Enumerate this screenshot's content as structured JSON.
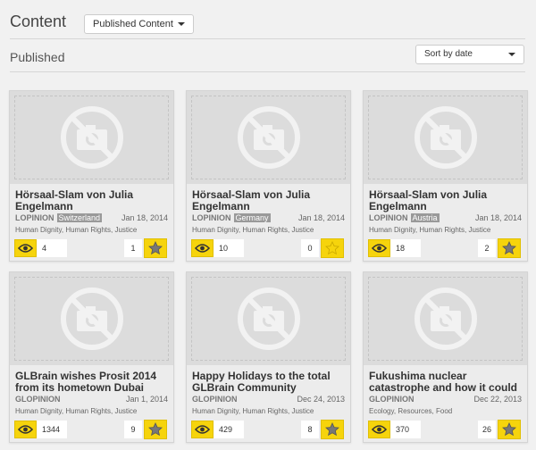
{
  "header": {
    "title": "Content",
    "filter": "Published Content",
    "section": "Published",
    "sort": "Sort by date"
  },
  "colors": {
    "accent": "#f6d40c",
    "tag_bg": "#999999"
  },
  "cards": [
    {
      "title": "Hörsaal-Slam von Julia Engelmann",
      "author": "LOPINION",
      "tag": "Switzerland",
      "date": "Jan 18, 2014",
      "topics": "Human Dignity, Human Rights, Justice",
      "views": "4",
      "count": "1",
      "starred": false
    },
    {
      "title": "Hörsaal-Slam von Julia Engelmann",
      "author": "LOPINION",
      "tag": "Germany",
      "date": "Jan 18, 2014",
      "topics": "Human Dignity, Human Rights, Justice",
      "views": "10",
      "count": "0",
      "starred": true
    },
    {
      "title": "Hörsaal-Slam von Julia Engelmann",
      "author": "LOPINION",
      "tag": "Austria",
      "date": "Jan 18, 2014",
      "topics": "Human Dignity, Human Rights, Justice",
      "views": "18",
      "count": "2",
      "starred": false
    },
    {
      "title": "GLBrain wishes Prosit 2014 from its hometown Dubai",
      "author": "GLOPINION",
      "tag": "",
      "date": "Jan 1, 2014",
      "topics": "Human Dignity, Human Rights, Justice",
      "views": "1344",
      "count": "9",
      "starred": false
    },
    {
      "title": "Happy Holidays to the total GLBrain Community",
      "author": "GLOPINION",
      "tag": "",
      "date": "Dec 24, 2013",
      "topics": "Human Dignity, Human Rights, Justice",
      "views": "429",
      "count": "8",
      "starred": false
    },
    {
      "title": "Fukushima nuclear catastrophe and how it could",
      "author": "GLOPINION",
      "tag": "",
      "date": "Dec 22, 2013",
      "topics": "Ecology, Resources, Food",
      "views": "370",
      "count": "26",
      "starred": false
    }
  ]
}
